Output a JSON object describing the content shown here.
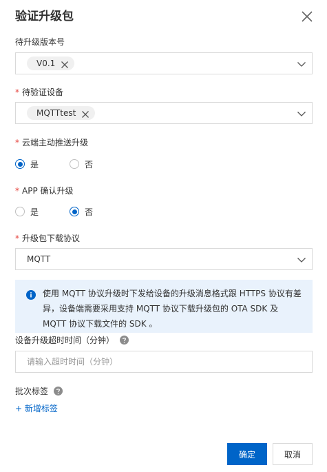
{
  "dialog": {
    "title": "验证升级包"
  },
  "fields": {
    "version": {
      "label": "待升级版本号",
      "tag": "V0.1"
    },
    "devices": {
      "label": "待验证设备",
      "tag": "MQTTtest"
    },
    "cloud_push": {
      "label": "云端主动推送升级",
      "options": [
        "是",
        "否"
      ],
      "selected": "是"
    },
    "app_confirm": {
      "label": "APP 确认升级",
      "options": [
        "是",
        "否"
      ],
      "selected": "否"
    },
    "protocol": {
      "label": "升级包下载协议",
      "value": "MQTT"
    },
    "notice": {
      "text": "使用 MQTT 协议升级时下发给设备的升级消息格式跟 HTTPS 协议有差异，设备端需要采用支持 MQTT 协议下载升级包的 OTA SDK 及 MQTT 协议下载文件的 SDK 。"
    },
    "timeout": {
      "label": "设备升级超时时间（分钟）",
      "placeholder": "请输入超时时间（分钟）",
      "value": ""
    },
    "batch_tags": {
      "label": "批次标签",
      "add_label": "+ 新增标签"
    }
  },
  "footer": {
    "confirm_label": "确定",
    "cancel_label": "取消"
  },
  "colors": {
    "primary": "#0064c8",
    "required": "#e5433d",
    "notice_bg": "#e9f2fc",
    "border": "#d9d9d9"
  },
  "icons": [
    "close-icon",
    "tag-remove-icon",
    "chevron-down-icon",
    "info-icon",
    "help-icon"
  ]
}
